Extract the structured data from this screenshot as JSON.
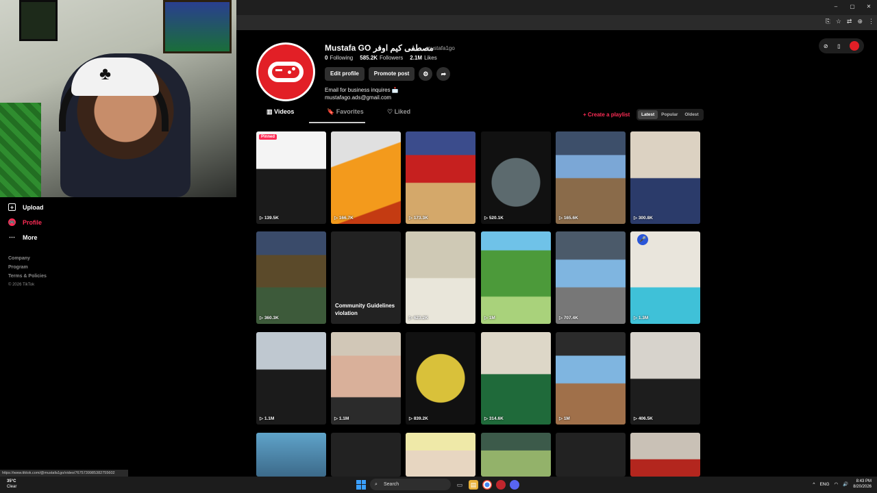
{
  "webcam": {
    "cap_emblem": "♣"
  },
  "leftnav": {
    "items": [
      {
        "label": "Upload",
        "icon": "upload-icon",
        "glyph": "+"
      },
      {
        "label": "Profile",
        "icon": "profile-icon",
        "glyph": "🎮"
      },
      {
        "label": "More",
        "icon": "more-icon",
        "glyph": "⋯"
      }
    ],
    "footer": [
      "Company",
      "Program",
      "Terms & Policies",
      "© 2026 TikTok"
    ]
  },
  "window_controls": {
    "minimize": "–",
    "maximize": "▢",
    "close": "✕"
  },
  "addr_icons": [
    "⎘",
    "☆",
    "⇄",
    "⊕",
    "⋮"
  ],
  "profile": {
    "name": "Mustafa GO مصطفى كيم اوفر",
    "handle": "mustafa1go",
    "following": "0",
    "following_label": "Following",
    "followers": "585.2K",
    "followers_label": "Followers",
    "likes": "2.1M",
    "likes_label": "Likes",
    "edit_label": "Edit profile",
    "promote_label": "Promote post",
    "bio_line1": "Email for business inquires 📩",
    "bio_line2": "mustafago.ads@gmail.com"
  },
  "tabs": [
    {
      "label": "Videos",
      "icon": "grid-icon",
      "glyph": "▥"
    },
    {
      "label": "Favorites",
      "icon": "bookmark-icon",
      "glyph": "🔖"
    },
    {
      "label": "Liked",
      "icon": "heart-icon",
      "glyph": "♡"
    }
  ],
  "create_playlist": "+ Create a playlist",
  "sort": {
    "options": [
      "Latest",
      "Popular",
      "Oldest"
    ],
    "selected": "Latest"
  },
  "colors": {
    "accent": "#fe2c55",
    "avatar_bg": "#e21f26",
    "page_bg": "#000000"
  },
  "videos": [
    {
      "views": "139.5K",
      "pinned": "Pinned",
      "bg": "linear-gradient(#f4f4f4 0 40%, #1b1b1b 41%)"
    },
    {
      "views": "166.7K",
      "bg": "linear-gradient(160deg, #e0e0e0 0 30%, #f39a1c 31% 80%, #c43b12 81%)"
    },
    {
      "views": "173.3K",
      "bg": "linear-gradient(#3b4c8c 0 25%, #c6201f 26% 55%, #d4a86a 56%)"
    },
    {
      "views": "520.1K",
      "bg": "radial-gradient(circle at 50% 55%, #5c6a6e 0 35px, #111 36px)"
    },
    {
      "views": "165.6K",
      "bg": "linear-gradient(#3d4f6a 0 25%, #7ba7d6 26% 50%, #8a6b4a 51%)"
    },
    {
      "views": "300.8K",
      "bg": "linear-gradient(#dcd2c2 0 50%, #2b3b6a 51%)"
    },
    {
      "views": "360.3K",
      "bg": "linear-gradient(#3a4b6a 0 25%, #5b4a2a 26% 60%, #3d5a3a 61%)"
    },
    {
      "views": "",
      "violation": "Community Guidelines violation",
      "bg": "#222222"
    },
    {
      "views": "623.2K",
      "bg": "linear-gradient(#cfc9b5 0 50%, #e9e6da 51%)"
    },
    {
      "views": "1M",
      "bg": "linear-gradient(#6fc2e8 0 20%, #4c9a3a 21% 70%, #a9d27b 71%)"
    },
    {
      "views": "707.4K",
      "bg": "linear-gradient(#4b5a6a 0 30%, #7fb5e0 31% 60%, #777 61%)"
    },
    {
      "views": "1.3M",
      "mic": "🎤",
      "bg": "linear-gradient(#e9e5dc 0 60%, #3fc1d8 61%)"
    },
    {
      "views": "1.1M",
      "bg": "linear-gradient(#bfc8d0 0 40%, #1b1b1b 41%)"
    },
    {
      "views": "1.1M",
      "bg": "linear-gradient(#d1c7b7 0 25%, #d9b09a 26% 70%, #2b2b2b 71%)"
    },
    {
      "views": "839.2K",
      "bg": "radial-gradient(circle at 50% 50%, #d9c13a 0 35px, #111 36px)"
    },
    {
      "views": "314.6K",
      "bg": "linear-gradient(#ddd7c8 0 45%, #1f6a3a 46%)"
    },
    {
      "views": "1M",
      "bg": "linear-gradient(#2b2b2b 0 25%, #7fb5e0 26% 55%, #a0704a 56%)"
    },
    {
      "views": "406.5K",
      "bg": "linear-gradient(#d7d3cc 0 50%, #1d1d1d 51%)"
    },
    {
      "views": "",
      "bg": "linear-gradient(#5fa3c9, #3c6a8a)"
    },
    {
      "views": "",
      "bg": "#222222"
    },
    {
      "views": "",
      "bg": "linear-gradient(#efe9a8 0 40%, #e7d6c1 41%)"
    },
    {
      "views": "",
      "bg": "linear-gradient(#3c5a4a 0 40%, #93b26a 41%)"
    },
    {
      "views": "",
      "bg": "#222222"
    },
    {
      "views": "",
      "bg": "linear-gradient(#c9c1b6 0 60%, #b3261e 61%)"
    }
  ],
  "status_url": "https://www.tiktok.com/@mustafa1go/video/7675739985382755602",
  "taskbar": {
    "temp": "35°C",
    "cond": "Clear",
    "search": "Search",
    "lang": "ENG",
    "time": "8:43 PM",
    "date": "8/20/2026"
  }
}
